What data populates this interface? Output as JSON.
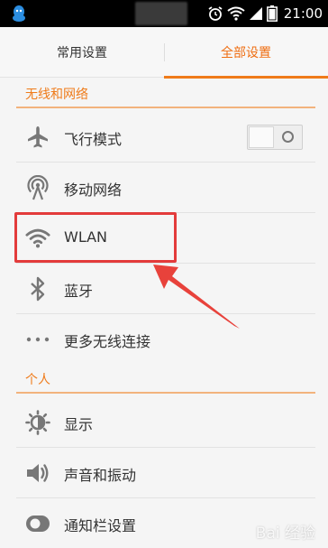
{
  "status_bar": {
    "time": "21:00",
    "left_icons": [
      "qq-icon"
    ],
    "right_icons": [
      "alarm-icon",
      "wifi-icon",
      "signal-icon",
      "battery-icon"
    ]
  },
  "tabs": {
    "common": "常用设置",
    "all": "全部设置",
    "active": "all"
  },
  "sections": [
    {
      "title": "无线和网络",
      "items": [
        {
          "label": "飞行模式",
          "icon": "airplane-icon",
          "toggle": "off"
        },
        {
          "label": "移动网络",
          "icon": "antenna-icon"
        },
        {
          "label": "WLAN",
          "icon": "wifi-icon"
        },
        {
          "label": "蓝牙",
          "icon": "bluetooth-icon"
        },
        {
          "label": "更多无线连接",
          "icon": "more-dots-icon"
        }
      ]
    },
    {
      "title": "个人",
      "items": [
        {
          "label": "显示",
          "icon": "brightness-icon"
        },
        {
          "label": "声音和振动",
          "icon": "speaker-icon"
        },
        {
          "label": "通知栏设置",
          "icon": "notification-toggle-icon"
        }
      ]
    }
  ],
  "annotation": {
    "highlight_color": "#e33b3b",
    "target": "WLAN"
  },
  "colors": {
    "accent": "#ef7b1a",
    "background": "#f5f5f5",
    "text": "#333333"
  },
  "watermark": "Bai 经验"
}
